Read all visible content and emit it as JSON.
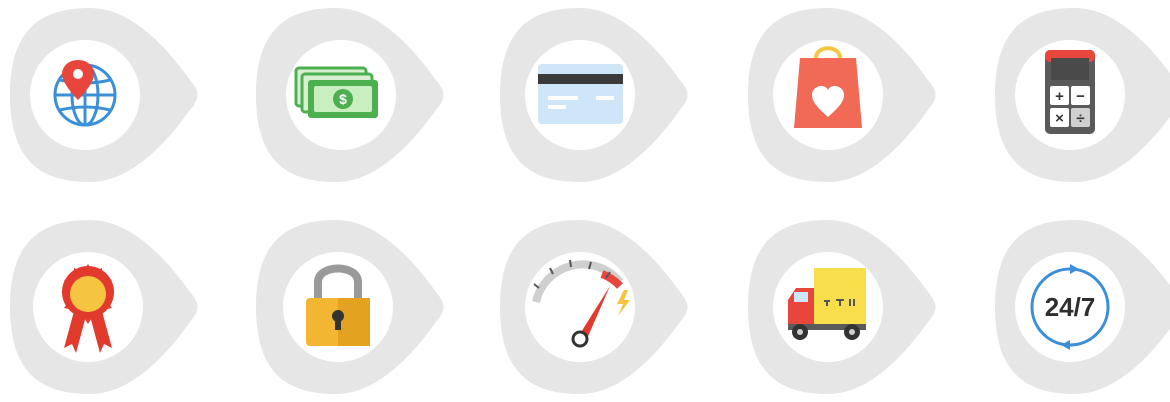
{
  "colors": {
    "pick_background": "#e6e6e6",
    "circle": "#ffffff",
    "globe_blue": "#3b8fd9",
    "pin_red": "#e8453c",
    "money_green": "#4caf50",
    "card_blue": "#cfe6f8",
    "bag_red": "#f06a55",
    "bag_handle": "#f5c542",
    "calc_gray": "#5a5a5a",
    "calc_red": "#e8453c",
    "ribbon_red": "#e23b2e",
    "medal_yellow": "#f5c542",
    "lock_yellow": "#f2b632",
    "truck_yellow": "#f9de4b",
    "truck_red": "#e8453c",
    "support_blue": "#3b8fd9"
  },
  "icons": [
    {
      "name": "globe-location-icon"
    },
    {
      "name": "money-icon"
    },
    {
      "name": "credit-card-icon"
    },
    {
      "name": "shopping-bag-heart-icon"
    },
    {
      "name": "calculator-icon"
    },
    {
      "name": "award-ribbon-icon"
    },
    {
      "name": "padlock-icon"
    },
    {
      "name": "speedometer-icon"
    },
    {
      "name": "delivery-truck-icon"
    },
    {
      "name": "support-24-7-icon"
    }
  ],
  "support_label": "24/7",
  "money_symbol": "$",
  "calculator_keys": [
    "+",
    "−",
    "×",
    "÷"
  ]
}
